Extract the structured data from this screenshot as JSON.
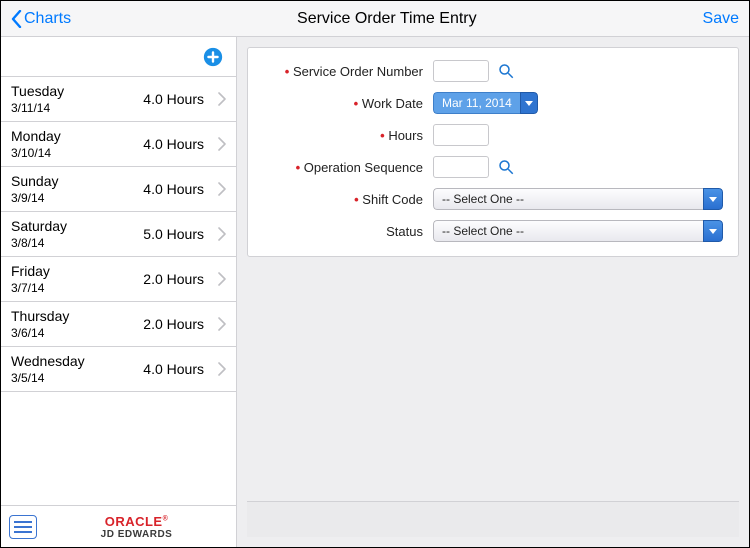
{
  "header": {
    "back_label": "Charts",
    "title": "Service Order Time Entry",
    "save_label": "Save"
  },
  "sidebar": {
    "items": [
      {
        "day": "Tuesday",
        "date": "3/11/14",
        "hours": "4.0 Hours"
      },
      {
        "day": "Monday",
        "date": "3/10/14",
        "hours": "4.0 Hours"
      },
      {
        "day": "Sunday",
        "date": "3/9/14",
        "hours": "4.0 Hours"
      },
      {
        "day": "Saturday",
        "date": "3/8/14",
        "hours": "5.0 Hours"
      },
      {
        "day": "Friday",
        "date": "3/7/14",
        "hours": "2.0 Hours"
      },
      {
        "day": "Thursday",
        "date": "3/6/14",
        "hours": "2.0 Hours"
      },
      {
        "day": "Wednesday",
        "date": "3/5/14",
        "hours": "4.0 Hours"
      }
    ],
    "brand_top": "ORACLE",
    "brand_sub": "JD EDWARDS"
  },
  "form": {
    "labels": {
      "service_order_number": "Service Order Number",
      "work_date": "Work Date",
      "hours": "Hours",
      "operation_sequence": "Operation Sequence",
      "shift_code": "Shift Code",
      "status": "Status"
    },
    "values": {
      "service_order_number": "",
      "work_date": "Mar 11, 2014",
      "hours": "",
      "operation_sequence": "",
      "shift_code": "-- Select One --",
      "status": "-- Select One --"
    }
  }
}
